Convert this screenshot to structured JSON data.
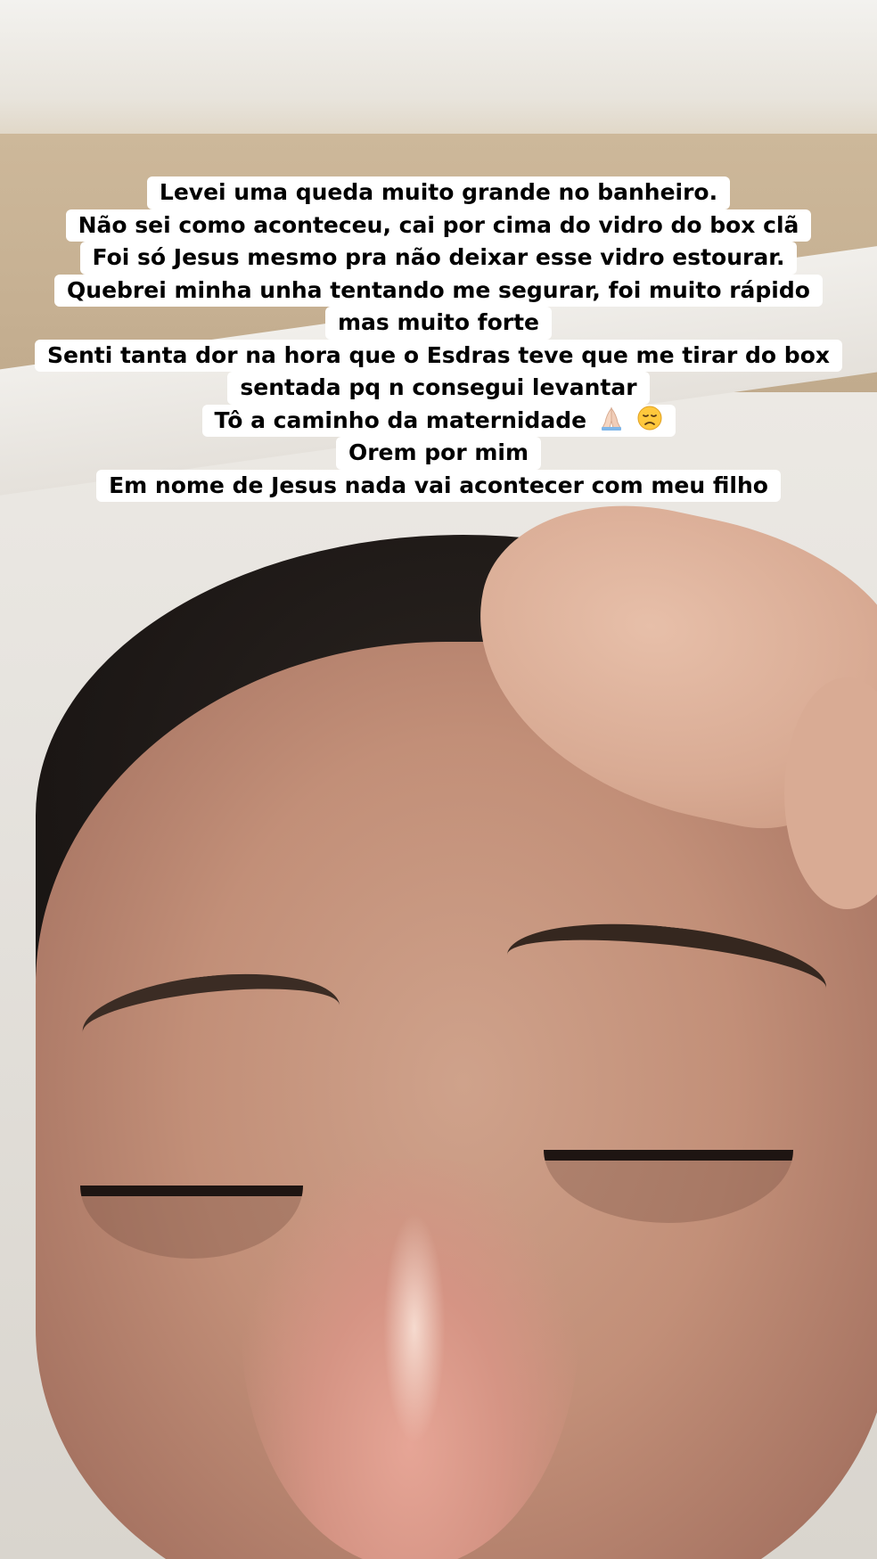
{
  "story": {
    "caption_lines": [
      "Levei uma queda muito grande no banheiro.",
      "Não sei como aconteceu, cai por cima do vidro do box clã",
      "Foi só Jesus mesmo pra não deixar esse vidro estourar.",
      "Quebrei minha unha tentando me segurar, foi muito rápido",
      "mas muito forte",
      "Senti tanta dor na hora que o Esdras teve que me tirar do box",
      "sentada pq n consegui levantar",
      "Tô a caminho da maternidade",
      "Orem por mim",
      "Em nome de Jesus nada vai acontecer com meu filho"
    ],
    "emojis": [
      "praying-hands-icon",
      "disappointed-face-icon"
    ],
    "caption_background": "#ffffff",
    "caption_text_color": "#000000"
  }
}
